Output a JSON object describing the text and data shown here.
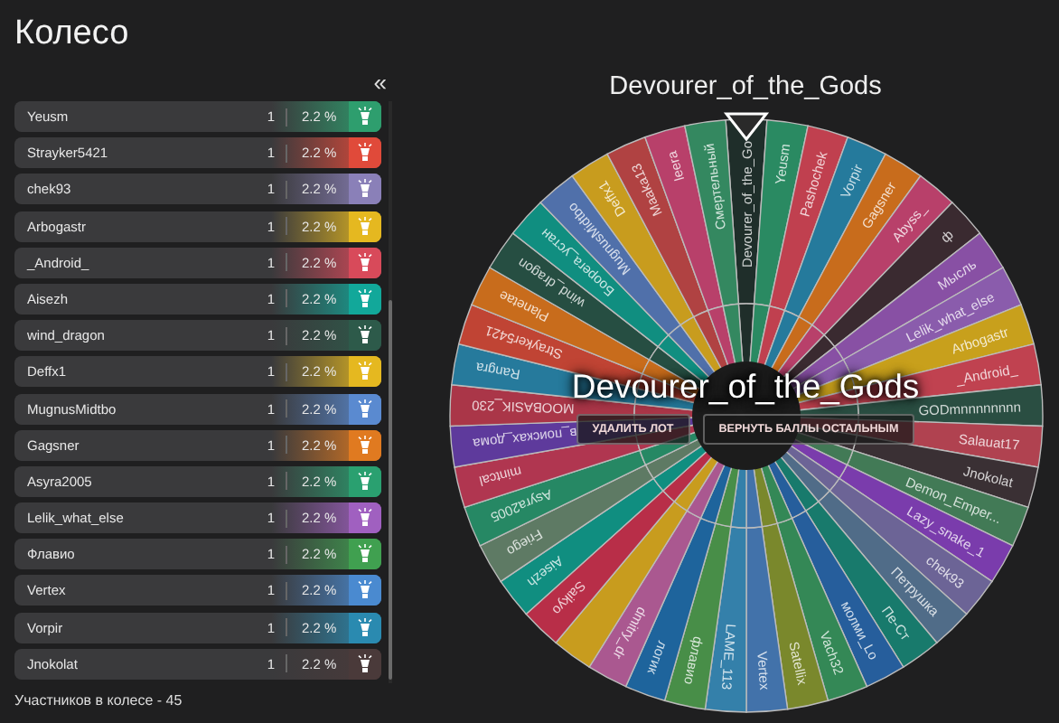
{
  "title": "Колесо",
  "collapse": "«",
  "participants": [
    {
      "name": "Yeusm",
      "count": "1",
      "percent": "2.2 %",
      "color": "#2e9e6e"
    },
    {
      "name": "Strayker5421",
      "count": "1",
      "percent": "2.2 %",
      "color": "#e04a3a"
    },
    {
      "name": "chek93",
      "count": "1",
      "percent": "2.2 %",
      "color": "#8a80b8"
    },
    {
      "name": "Arbogastr",
      "count": "1",
      "percent": "2.2 %",
      "color": "#e5b820"
    },
    {
      "name": "_Android_",
      "count": "1",
      "percent": "2.2 %",
      "color": "#d84a5a"
    },
    {
      "name": "Aisezh",
      "count": "1",
      "percent": "2.2 %",
      "color": "#12a89a"
    },
    {
      "name": "wind_dragon",
      "count": "1",
      "percent": "2.2 %",
      "color": "#2d5a4a"
    },
    {
      "name": "Deffx1",
      "count": "1",
      "percent": "2.2 %",
      "color": "#e5b820"
    },
    {
      "name": "MugnusMidtbo",
      "count": "1",
      "percent": "2.2 %",
      "color": "#5a8ad0"
    },
    {
      "name": "Gagsner",
      "count": "1",
      "percent": "2.2 %",
      "color": "#e07a20"
    },
    {
      "name": "Asyra2005",
      "count": "1",
      "percent": "2.2 %",
      "color": "#2aa070"
    },
    {
      "name": "Lelik_what_else",
      "count": "1",
      "percent": "2.2 %",
      "color": "#a060c0"
    },
    {
      "name": "Флавио",
      "count": "1",
      "percent": "2.2 %",
      "color": "#40a050"
    },
    {
      "name": "Vertex",
      "count": "1",
      "percent": "2.2 %",
      "color": "#4a8ad0"
    },
    {
      "name": "Vorpir",
      "count": "1",
      "percent": "2.2 %",
      "color": "#2a8ab0"
    },
    {
      "name": "Jnokolat",
      "count": "1",
      "percent": "2.2 %",
      "color": "#4a3a3a"
    }
  ],
  "footer": "Участников в колесе - 45",
  "wheel": {
    "title": "Devourer_of_the_Gods",
    "winner": "Devourer_of_the_Gods",
    "buttons": [
      "УДАЛИТЬ ЛОТ",
      "ВЕРНУТЬ БАЛЛЫ ОСТАЛЬНЫМ"
    ],
    "segments": [
      {
        "label": "Devourer_of_the_Go",
        "color": "#1f2e2a"
      },
      {
        "label": "Yeusm",
        "color": "#2a8a62"
      },
      {
        "label": "Pashochek",
        "color": "#c0404f"
      },
      {
        "label": "Vorpir",
        "color": "#257a9c"
      },
      {
        "label": "Gagsner",
        "color": "#c86c1c"
      },
      {
        "label": "Abyss_",
        "color": "#b8406a"
      },
      {
        "label": "ф",
        "color": "#3a2a30"
      },
      {
        "label": "Мысль",
        "color": "#8850a4"
      },
      {
        "label": "Lelik_what_else",
        "color": "#8a5cac"
      },
      {
        "label": "Arbogastr",
        "color": "#c8a01c"
      },
      {
        "label": "_Android_",
        "color": "#c04250"
      },
      {
        "label": "GODmnnnnnnnn",
        "color": "#2a4e42"
      },
      {
        "label": "Salauat17",
        "color": "#b04250"
      },
      {
        "label": "Jnokolat",
        "color": "#3a3034"
      },
      {
        "label": "Demon_Emper...",
        "color": "#427a56"
      },
      {
        "label": "Lazy_snake_1",
        "color": "#7a3cac"
      },
      {
        "label": "chek93",
        "color": "#6c6496"
      },
      {
        "label": "Петрушка",
        "color": "#506c88"
      },
      {
        "label": "Пе-Ст",
        "color": "#187a6c"
      },
      {
        "label": "молми_Lo",
        "color": "#265e9c"
      },
      {
        "label": "Vach32",
        "color": "#348856"
      },
      {
        "label": "Satellix",
        "color": "#7a882c"
      },
      {
        "label": "Vertex",
        "color": "#4272aa"
      },
      {
        "label": "LAME_113",
        "color": "#3480aa"
      },
      {
        "label": "флавио",
        "color": "#488e48"
      },
      {
        "label": "логик",
        "color": "#1e649c"
      },
      {
        "label": "dmitry_dr",
        "color": "#aa5890"
      },
      {
        "color": "#c89c1e"
      },
      {
        "label": "Saikyo",
        "color": "#b82e48"
      },
      {
        "label": "Aisezh",
        "color": "#108e80"
      },
      {
        "label": "Friego",
        "color": "#5e7a64"
      },
      {
        "label": "Asyra2005",
        "color": "#268864"
      },
      {
        "label": "mintcal",
        "color": "#b03650"
      },
      {
        "label": "в_поисках_дома",
        "color": "#5e3a9c"
      },
      {
        "label": "MOOBASIK_230",
        "color": "#aa3648"
      },
      {
        "label": "Rangra",
        "color": "#267a9c"
      },
      {
        "label": "Strayker5421",
        "color": "#c04434"
      },
      {
        "label": "Planetae",
        "color": "#c86c1c"
      },
      {
        "label": "wind_dragon",
        "color": "#264e42"
      },
      {
        "label": "Боорега_устан",
        "color": "#108e80"
      },
      {
        "label": "MugnusMidtbo",
        "color": "#5070aa"
      },
      {
        "label": "Deffx1",
        "color": "#c89c1e"
      },
      {
        "label": "Maaka13",
        "color": "#b04242"
      },
      {
        "label": "leera",
        "color": "#b8406a"
      },
      {
        "label": "Смертельный",
        "color": "#348860"
      }
    ]
  }
}
